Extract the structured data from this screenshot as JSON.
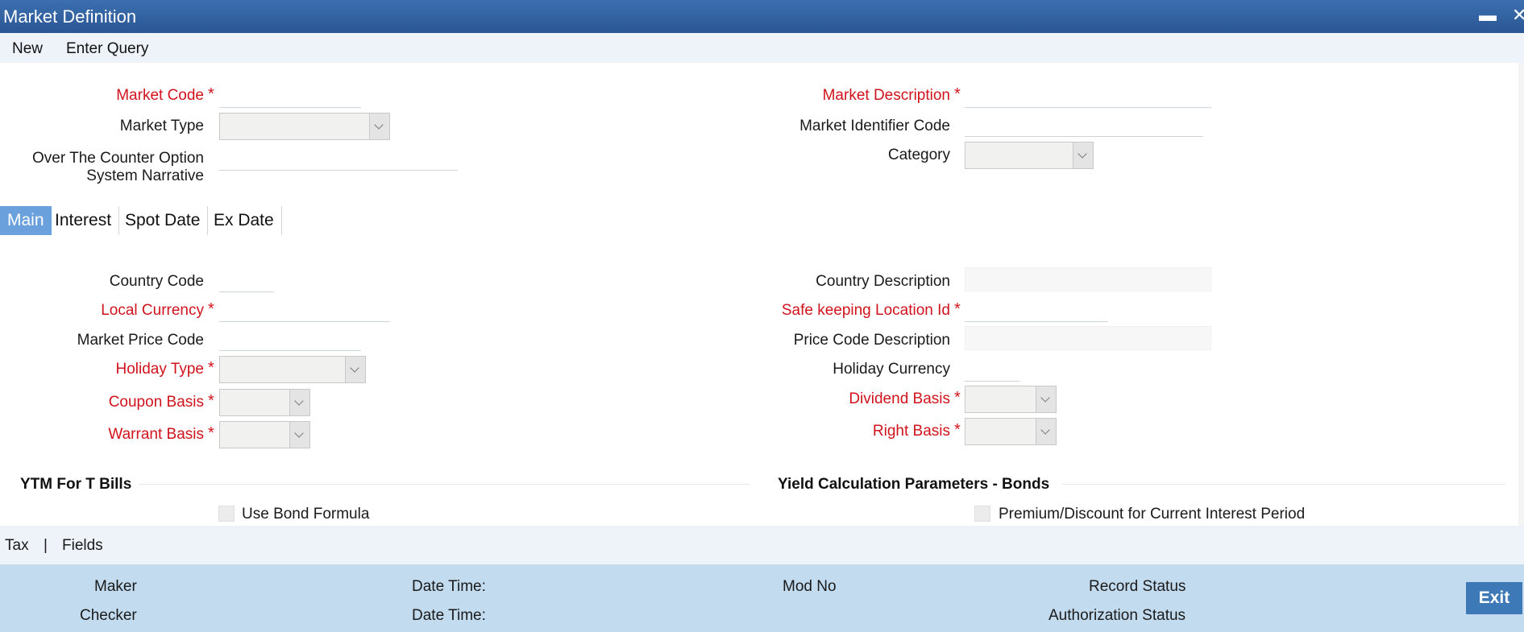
{
  "window": {
    "title": "Market Definition",
    "minimize": "▬",
    "close": "✕"
  },
  "toolbar": {
    "new": "New",
    "enter_query": "Enter Query"
  },
  "header": {
    "market_code": "Market Code",
    "market_type": "Market Type",
    "otc_line1": "Over The Counter Option",
    "otc_line2": "System Narrative",
    "market_description": "Market Description",
    "market_identifier_code": "Market Identifier Code",
    "category": "Category"
  },
  "tabs": [
    {
      "label": "Main"
    },
    {
      "label": "Interest"
    },
    {
      "label": "Spot Date"
    },
    {
      "label": "Ex Date"
    }
  ],
  "main": {
    "country_code": "Country Code",
    "local_currency": "Local Currency",
    "market_price_code": "Market Price Code",
    "holiday_type": "Holiday Type",
    "coupon_basis": "Coupon Basis",
    "warrant_basis": "Warrant Basis",
    "country_description": "Country Description",
    "safekeeping_location_id": "Safe keeping Location Id",
    "price_code_description": "Price Code Description",
    "holiday_currency": "Holiday Currency",
    "dividend_basis": "Dividend Basis",
    "right_basis": "Right Basis"
  },
  "sections": {
    "ytm_title": "YTM For T Bills",
    "use_bond_formula": "Use Bond Formula",
    "yield_title": "Yield Calculation Parameters - Bonds",
    "premium_discount": "Premium/Discount for Current Interest Period"
  },
  "subbar": {
    "tax": "Tax",
    "sep": "|",
    "fields": "Fields"
  },
  "footer": {
    "maker": "Maker",
    "checker": "Checker",
    "date_time_1": "Date Time:",
    "date_time_2": "Date Time:",
    "mod_no": "Mod No",
    "record_status": "Record Status",
    "authorization_status": "Authorization Status",
    "exit": "Exit"
  },
  "required_marker": "*"
}
